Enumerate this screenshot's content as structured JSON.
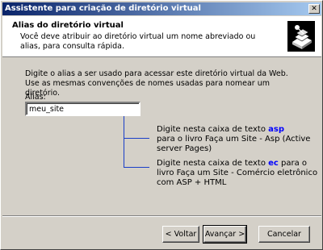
{
  "window": {
    "title": "Assistente para criação de diretório virtual",
    "close_glyph": "✕"
  },
  "header": {
    "title": "Alias do diretório virtual",
    "description": "Você deve atribuir ao diretório virtual um nome abreviado ou alias, para consulta rápida.",
    "icon": "wizard-folder-icon"
  },
  "body": {
    "instructions": "Digite o alias a ser usado para acessar este diretório virtual da Web. Use as mesmas convenções de nomes usadas para nomear um diretório.",
    "alias_label": "Alias:",
    "alias_value": "meu_site"
  },
  "notes": {
    "note1_pre": "Digite nesta caixa de texto ",
    "note1_kw": "asp",
    "note1_post": "para o livro Faça um Site - Asp (Active server Pages)",
    "note2_pre": "Digite nesta caixa de texto ",
    "note2_kw": "ec",
    "note2_post": " para o livro Faça um Site - Comércio eletrônico com ASP + HTML",
    "accent_color": "#0000ff"
  },
  "buttons": {
    "back": "< Voltar",
    "next": "Avançar >",
    "cancel": "Cancelar"
  }
}
